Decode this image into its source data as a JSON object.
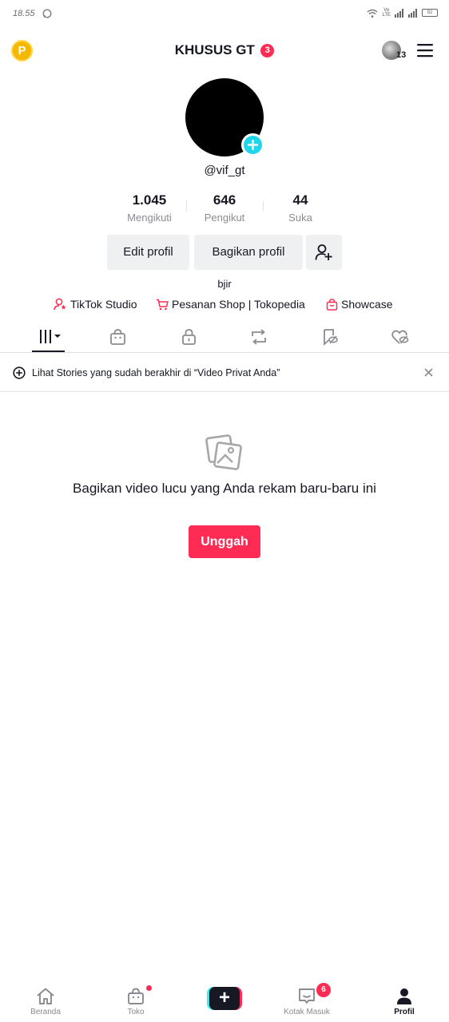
{
  "status_bar": {
    "time": "18.55",
    "battery": "92"
  },
  "header": {
    "title": "KHUSUS GT",
    "title_badge": "3",
    "coin_label": "P",
    "friends_count": "13"
  },
  "profile": {
    "username": "@vif_gt",
    "stats": [
      {
        "value": "1.045",
        "label": "Mengikuti"
      },
      {
        "value": "646",
        "label": "Pengikut"
      },
      {
        "value": "44",
        "label": "Suka"
      }
    ],
    "edit_label": "Edit profil",
    "share_label": "Bagikan profil",
    "bio": "bjir",
    "links": [
      {
        "label": "TikTok Studio",
        "icon": "creator-star-icon"
      },
      {
        "label": "Pesanan Shop | Tokopedia",
        "icon": "shopping-cart-icon"
      },
      {
        "label": "Showcase",
        "icon": "shopping-bag-icon"
      }
    ]
  },
  "tabs": [
    {
      "name": "videos-grid-icon",
      "active": true
    },
    {
      "name": "shop-bag-icon",
      "active": false
    },
    {
      "name": "lock-icon",
      "active": false
    },
    {
      "name": "repost-icon",
      "active": false
    },
    {
      "name": "bookmark-icon",
      "active": false
    },
    {
      "name": "liked-heart-icon",
      "active": false
    }
  ],
  "stories_banner": {
    "text": "Lihat Stories yang sudah berakhir di “Video Privat Anda”"
  },
  "empty_state": {
    "title": "Bagikan video lucu yang Anda rekam baru-baru ini",
    "button": "Unggah"
  },
  "bottom_nav": {
    "items": [
      {
        "label": "Beranda",
        "icon": "home-icon"
      },
      {
        "label": "Toko",
        "icon": "shop-icon"
      },
      {
        "label": "",
        "icon": "create-plus-icon"
      },
      {
        "label": "Kotak Masuk",
        "icon": "inbox-icon",
        "badge": "6"
      },
      {
        "label": "Profil",
        "icon": "profile-icon"
      }
    ]
  },
  "colors": {
    "accent": "#fe2c55",
    "cyan": "#25f4ee",
    "text": "#161823",
    "secondary": "#8a8b91"
  }
}
